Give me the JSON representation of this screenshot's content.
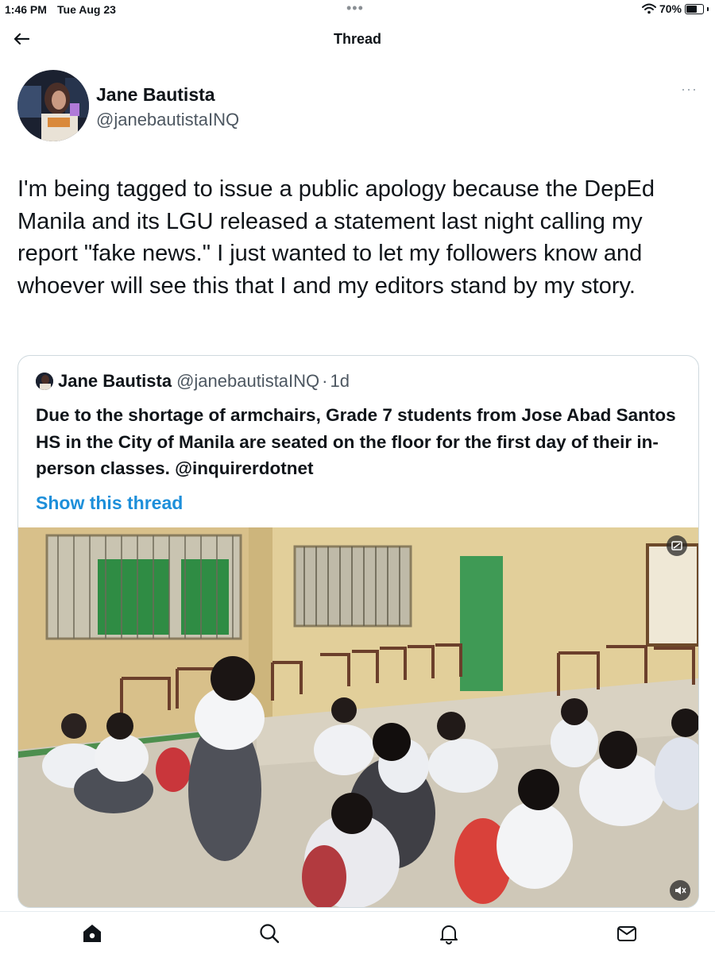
{
  "status_bar": {
    "time": "1:46 PM",
    "date": "Tue Aug 23",
    "dots": "•••",
    "battery": "70%",
    "battery_level": 0.7
  },
  "nav": {
    "title": "Thread",
    "back_icon": "back-arrow-icon"
  },
  "author": {
    "name": "Jane Bautista",
    "handle": "@janebautistaINQ",
    "more": "···"
  },
  "tweet": {
    "text": "I'm being tagged to issue a public apology because the DepEd Manila and its LGU released a statement last night calling my report \"fake news.\" I just wanted to let my followers know and whoever will see this that I and my editors stand by my story."
  },
  "quote": {
    "name": "Jane Bautista",
    "handle": "@janebautistaINQ",
    "separator": "·",
    "time": "1d",
    "text": "Due to the shortage of armchairs, Grade 7 students from Jose Abad Santos HS in the City of Manila are seated on the floor for the first day of their in-person classes. @inquirerdotnet",
    "show_thread": "Show this thread",
    "media_icons": [
      "gif-icon",
      "mute-icon"
    ]
  },
  "tab_bar": {
    "items": [
      "home-icon",
      "search-icon",
      "notifications-icon",
      "messages-icon"
    ]
  },
  "colors": {
    "accent": "#1d8fda",
    "text": "#0f1419",
    "secondary": "#4d5761",
    "border": "#cfd9de"
  }
}
